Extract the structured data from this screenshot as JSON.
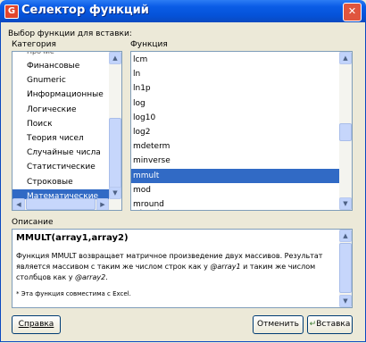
{
  "window": {
    "title": "Селектор функций",
    "close_glyph": "✕"
  },
  "prompt": "Выбор функции для вставки:",
  "category": {
    "label": "Категория",
    "items": [
      "Финансовые",
      "Gnumeric",
      "Информационные",
      "Логические",
      "Поиск",
      "Теория чисел",
      "Случайные числа",
      "Статистические",
      "Строковые",
      "Математические"
    ],
    "selected": "Математические"
  },
  "function": {
    "label": "Функция",
    "items": [
      "lcm",
      "ln",
      "ln1p",
      "log",
      "log10",
      "log2",
      "mdeterm",
      "minverse",
      "mmult",
      "mod",
      "mround"
    ],
    "selected": "mmult"
  },
  "description": {
    "label": "Описание",
    "signature": "MMULT(array1,array2)",
    "text_part1": "Функция MMULT возвращает матричное произведение двух массивов. Результат является массивом с таким же числом строк как у ",
    "arg1": "@array1",
    "text_part2": " и таким же числом столбцов как у ",
    "arg2": "@array2",
    "text_part3": ".",
    "note": "* Эта функция совместима с Excel."
  },
  "buttons": {
    "help": "Справка",
    "cancel": "Отменить",
    "insert": "Вставка"
  }
}
